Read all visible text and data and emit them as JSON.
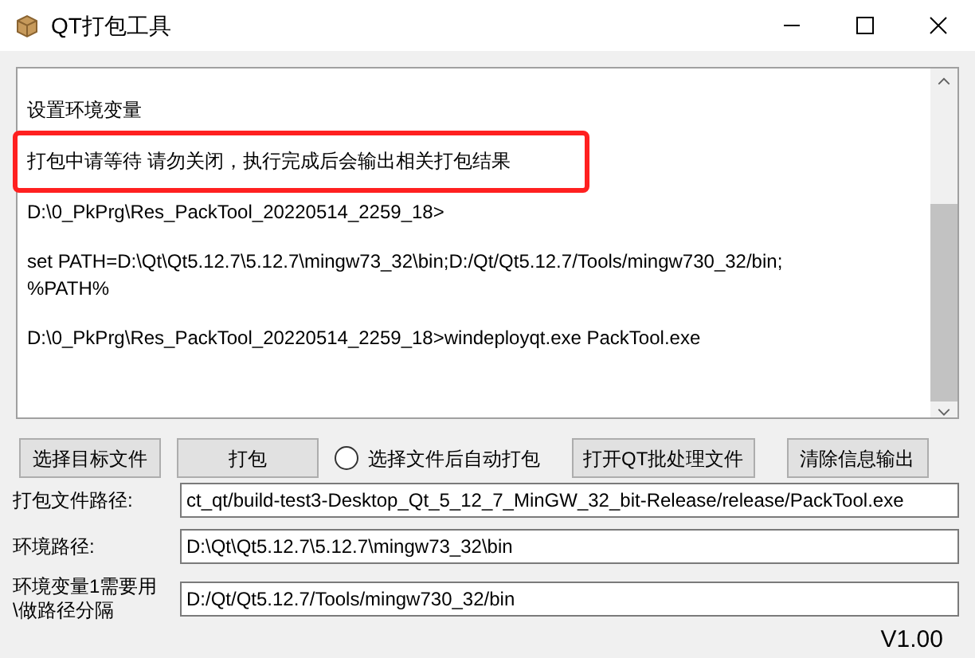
{
  "window": {
    "title": "QT打包工具"
  },
  "log": {
    "lines": [
      {
        "text": "设置环境变量",
        "highlighted": false
      },
      {
        "text": "打包中请等待 请勿关闭，执行完成后会输出相关打包结果",
        "highlighted": true
      },
      {
        "text": "D:\\0_PkPrg\\Res_PackTool_20220514_2259_18>",
        "highlighted": false
      },
      {
        "text": "set PATH=D:\\Qt\\Qt5.12.7\\5.12.7\\mingw73_32\\bin;D:/Qt/Qt5.12.7/Tools/mingw730_32/bin;\n%PATH%",
        "highlighted": false
      },
      {
        "text": "D:\\0_PkPrg\\Res_PackTool_20220514_2259_18>windeployqt.exe PackTool.exe",
        "highlighted": false
      }
    ]
  },
  "toolbar": [
    {
      "kind": "button",
      "label": "选择目标文件"
    },
    {
      "kind": "button",
      "label": "打包"
    },
    {
      "kind": "radio",
      "label": "选择文件后自动打包",
      "checked": false
    },
    {
      "kind": "button",
      "label": "打开QT批处理文件"
    },
    {
      "kind": "button",
      "label": "清除信息输出"
    }
  ],
  "fields": [
    {
      "label": "打包文件路径:",
      "value": "ct_qt/build-test3-Desktop_Qt_5_12_7_MinGW_32_bit-Release/release/PackTool.exe"
    },
    {
      "label": "环境路径:",
      "value": "D:\\Qt\\Qt5.12.7\\5.12.7\\mingw73_32\\bin"
    },
    {
      "label": "环境变量1需要用\\做路径分隔",
      "value": "D:/Qt/Qt5.12.7/Tools/mingw730_32/bin"
    }
  ],
  "status_bar": {
    "version": "V1.00"
  }
}
